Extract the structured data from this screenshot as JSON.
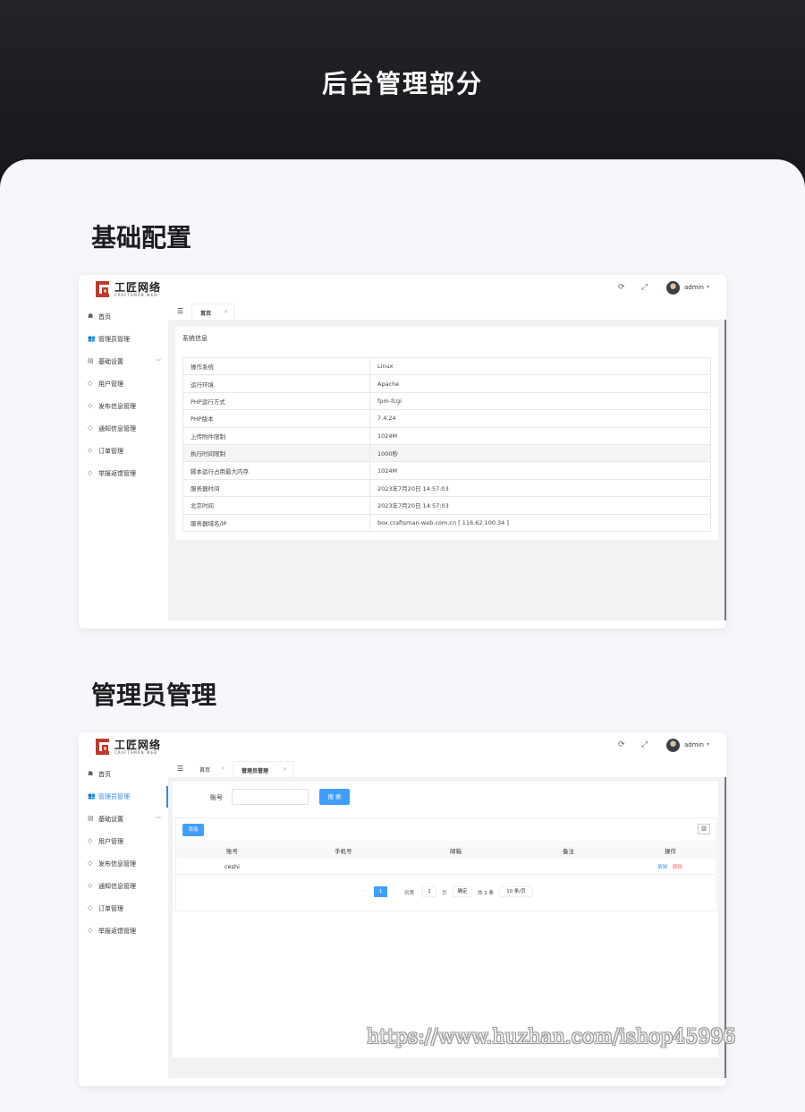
{
  "hero": {
    "title": "后台管理部分"
  },
  "sections": {
    "basic": {
      "title": "基础配置"
    },
    "admin": {
      "title": "管理员管理"
    }
  },
  "app": {
    "logo_cn": "工匠网络",
    "logo_en": "CRAFTSMAN WEB",
    "user": "admin",
    "accent": "#2d8cf0",
    "brand_red": "#c0392b",
    "sidebar": [
      {
        "icon": "dashboard-icon",
        "label": "首页"
      },
      {
        "icon": "users-icon",
        "label": "管理员管理"
      },
      {
        "icon": "file-icon",
        "label": "基础设置"
      },
      {
        "icon": "shield-icon",
        "label": "用户管理"
      },
      {
        "icon": "shield-icon",
        "label": "发布信息管理"
      },
      {
        "icon": "shield-icon",
        "label": "通知信息管理"
      },
      {
        "icon": "shield-icon",
        "label": "订单管理"
      },
      {
        "icon": "shield-icon",
        "label": "举报返馈管理"
      }
    ]
  },
  "win1": {
    "tabs": [
      {
        "label": "首页"
      }
    ],
    "card_title": "系统信息",
    "info_rows": [
      {
        "k": "操作系统",
        "v": "Linux"
      },
      {
        "k": "运行环境",
        "v": "Apache"
      },
      {
        "k": "PHP运行方式",
        "v": "fpm-fcgi"
      },
      {
        "k": "PHP版本",
        "v": "7.4.24"
      },
      {
        "k": "上传附件限制",
        "v": "1024M"
      },
      {
        "k": "执行时间限制",
        "v": "1000秒"
      },
      {
        "k": "脚本运行占用最大内存",
        "v": "1024M"
      },
      {
        "k": "服务器时间",
        "v": "2023年7月20日 14:57:03"
      },
      {
        "k": "北京时间",
        "v": "2023年7月20日 14:57:03"
      },
      {
        "k": "服务器域名/IP",
        "v": "box.craftsman-web.com.cn [ 116.62.100.34 ]"
      }
    ]
  },
  "win2": {
    "tabs": [
      {
        "label": "首页"
      },
      {
        "label": "管理员管理"
      }
    ],
    "search_label": "账号",
    "search_value": "",
    "search_button": "搜 索",
    "add_button": "添加",
    "columns": [
      "账号",
      "手机号",
      "邮箱",
      "备注",
      "操作"
    ],
    "rows": [
      {
        "account": "ceshi",
        "phone": "",
        "email": "",
        "note": "",
        "edit": "编辑",
        "delete": "删除"
      }
    ],
    "pager": {
      "current": "1",
      "goto_label": "到第",
      "goto_value": "1",
      "page_unit": "页",
      "confirm": "确定",
      "total": "共 1 条",
      "page_size": "10 条/页"
    }
  },
  "watermark": "https://www.huzhan.com/ishop45996"
}
